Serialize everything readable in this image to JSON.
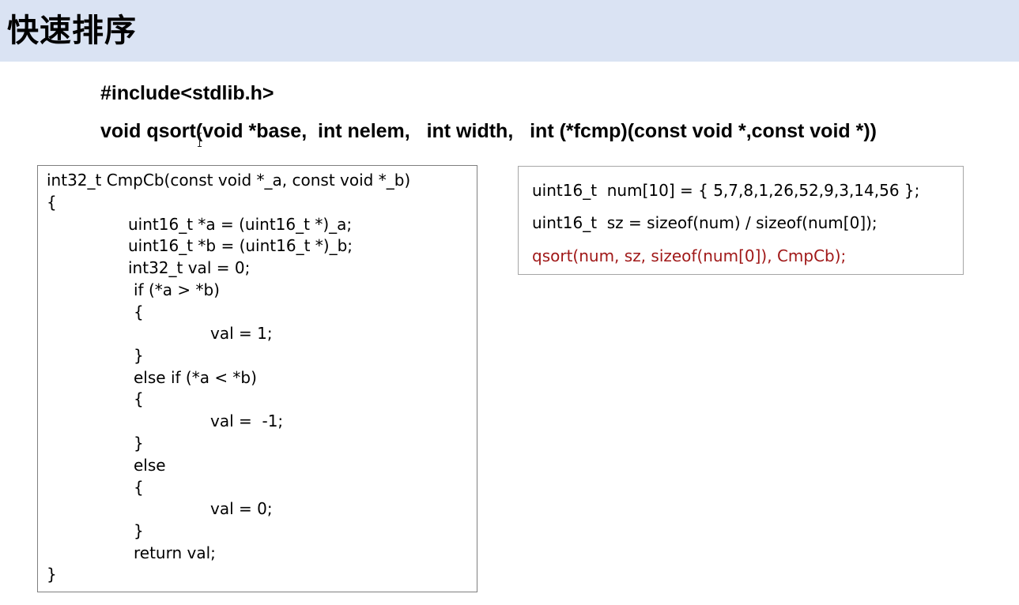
{
  "slide": {
    "title": "快速排序"
  },
  "heading": {
    "include_line": "#include<stdlib.h>",
    "qsort_signature": "void qsort(void *base,  int nelem,   int width,   int (*fcmp)(const void *,const void *))"
  },
  "compare_function": {
    "lines": [
      "int32_t CmpCb(const void *_a, const void *_b)",
      "{",
      "uint16_t *a = (uint16_t *)_a;",
      "uint16_t *b = (uint16_t *)_b;",
      "int32_t val = 0;",
      "if (*a > *b)",
      "{",
      "val = 1;",
      "}",
      "else if (*a < *b)",
      "{",
      "val =  -1;",
      "}",
      "else",
      "{",
      "val = 0;",
      "}",
      "return val;",
      "}"
    ]
  },
  "usage_example": {
    "lines": [
      "uint16_t  num[10] = { 5,7,8,1,26,52,9,3,14,56 };",
      "uint16_t  sz = sizeof(num) / sizeof(num[0]);",
      "qsort(num, sz, sizeof(num[0]), CmpCb);"
    ],
    "highlight_color": "#a01818"
  },
  "colors": {
    "title_background": "#dae3f3",
    "text": "#000000",
    "box_border": "#7f7f7f"
  }
}
